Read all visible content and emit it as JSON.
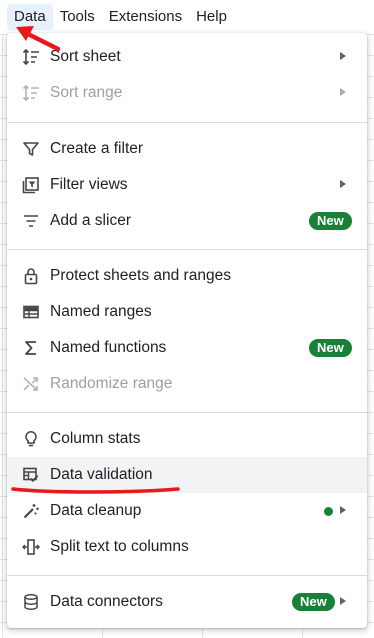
{
  "menubar": {
    "items": [
      {
        "label": "Data"
      },
      {
        "label": "Tools"
      },
      {
        "label": "Extensions"
      },
      {
        "label": "Help"
      }
    ]
  },
  "menu": {
    "items": [
      {
        "label": "Sort sheet",
        "icon": "sort-icon",
        "submenu": true,
        "enabled": true
      },
      {
        "label": "Sort range",
        "icon": "sort-icon",
        "submenu": true,
        "enabled": false
      },
      {
        "label": "Create a filter",
        "icon": "filter-icon",
        "enabled": true
      },
      {
        "label": "Filter views",
        "icon": "filter-views-icon",
        "submenu": true,
        "enabled": true
      },
      {
        "label": "Add a slicer",
        "icon": "slicer-icon",
        "badge": "New",
        "enabled": true
      },
      {
        "label": "Protect sheets and ranges",
        "icon": "lock-icon",
        "enabled": true
      },
      {
        "label": "Named ranges",
        "icon": "named-ranges-icon",
        "enabled": true
      },
      {
        "label": "Named functions",
        "icon": "sigma-icon",
        "badge": "New",
        "enabled": true
      },
      {
        "label": "Randomize range",
        "icon": "shuffle-icon",
        "enabled": false
      },
      {
        "label": "Column stats",
        "icon": "lightbulb-icon",
        "enabled": true
      },
      {
        "label": "Data validation",
        "icon": "data-validation-icon",
        "enabled": true,
        "highlighted": true
      },
      {
        "label": "Data cleanup",
        "icon": "magic-wand-icon",
        "submenu": true,
        "status_dot": true,
        "enabled": true
      },
      {
        "label": "Split text to columns",
        "icon": "split-columns-icon",
        "enabled": true
      },
      {
        "label": "Data connectors",
        "icon": "database-icon",
        "badge": "New",
        "submenu": true,
        "enabled": true
      }
    ]
  },
  "colors": {
    "badge_bg": "#188038",
    "highlight_bg": "#f1f3f4",
    "menubar_active_bg": "#e8f0fe",
    "annotation_red": "#e8191d",
    "disabled_text": "#9aa0a6"
  }
}
